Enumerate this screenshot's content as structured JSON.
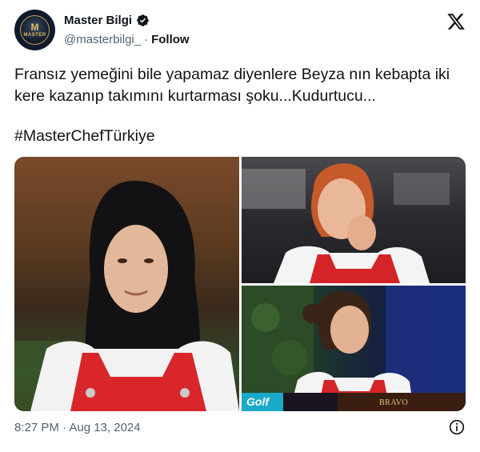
{
  "author": {
    "display_name": "Master Bilgi",
    "handle": "@masterbilgi_",
    "follow_label": "Follow",
    "separator": "·",
    "avatar_text": "M",
    "avatar_word": "MASTER"
  },
  "tweet": {
    "text": "Fransız yemeğini bile yapamaz diyenlere Beyza nın kebapta iki kere kazanıp takımını kurtarması şoku...Kudurtucu...",
    "hashtag": "#MasterChefTürkiye"
  },
  "media": {
    "bottom_right_logo_left": "Golf",
    "bottom_right_logo_right": "BRAVO"
  },
  "footer": {
    "timestamp": "8:27 PM · Aug 13, 2024"
  },
  "colors": {
    "text_primary": "#0f1419",
    "text_secondary": "#536471",
    "verified_badge": "#0f1419"
  },
  "icons": {
    "verified": "verified-badge-icon",
    "platform": "x-logo-icon",
    "info": "info-icon"
  }
}
